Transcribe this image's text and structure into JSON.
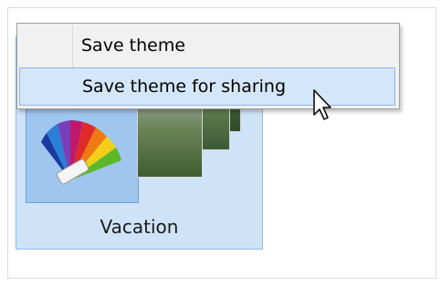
{
  "theme_tile": {
    "name": "Vacation",
    "icon": "color-palette-icon",
    "photos": [
      "vacation-photo-icon",
      "vacation-photo-icon",
      "vacation-photo-icon"
    ]
  },
  "context_menu": {
    "items": [
      {
        "label": "Save theme"
      },
      {
        "label": "Save theme for sharing",
        "highlighted": true
      }
    ]
  },
  "cursor": "mouse-pointer-icon",
  "colors": {
    "selection_fill": "#cfe3f8",
    "selection_border": "#8fb9e6",
    "menu_highlight": "#d4e6f9",
    "menu_background": "#f1f1f1"
  }
}
